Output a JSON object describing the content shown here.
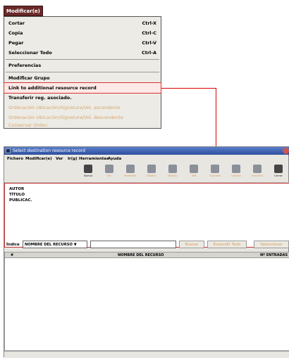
{
  "menu": {
    "title": "Modificar(e)",
    "items": [
      {
        "label": "Cortar",
        "accel": "Ctrl-X"
      },
      {
        "label": "Copia",
        "accel": "Ctrl-C"
      },
      {
        "label": "Pegar",
        "accel": "Ctrl-V"
      },
      {
        "label": "Seleccionar Todo",
        "accel": "Ctrl-A"
      },
      {
        "label": "Preferencias",
        "accel": ""
      },
      {
        "label": "Modificar Grupo",
        "accel": ""
      },
      {
        "label": "Link to additional resource record",
        "accel": ""
      },
      {
        "label": "Transferir reg. asociado.",
        "accel": ""
      },
      {
        "label": "Ordenación Ubicación/Signatura/Vol. ascendente",
        "accel": ""
      },
      {
        "label": "Ordenación Ubicación/Signatura/Vol. descendente",
        "accel": ""
      },
      {
        "label": "Conservar Orden",
        "accel": ""
      }
    ]
  },
  "window": {
    "title": "Select destination resource record",
    "menubar": [
      "Fichero",
      "Modificar(e)",
      "Ver",
      "Ir(g)",
      "Herramientas",
      "Ayuda"
    ],
    "toolbar": [
      "Nuevo",
      "Ver",
      "Modificar",
      "Nota(t)",
      "Nota(t)",
      "WB",
      "Sumario",
      "Listado",
      "Imprimir",
      "Cerrar"
    ],
    "info_lines": [
      "AUTOR",
      "TÍTULO",
      "PUBLICAC."
    ],
    "search": {
      "index_label": "Índice",
      "index_value": "NOMBRE DEL RECURSO",
      "buttons": [
        "Buscar",
        "Expandir Todo",
        "Seleccionar"
      ]
    },
    "grid": {
      "headers": [
        "#",
        "NOMBRE DEL RECURSO",
        "Nº ENTRADAS"
      ]
    }
  }
}
